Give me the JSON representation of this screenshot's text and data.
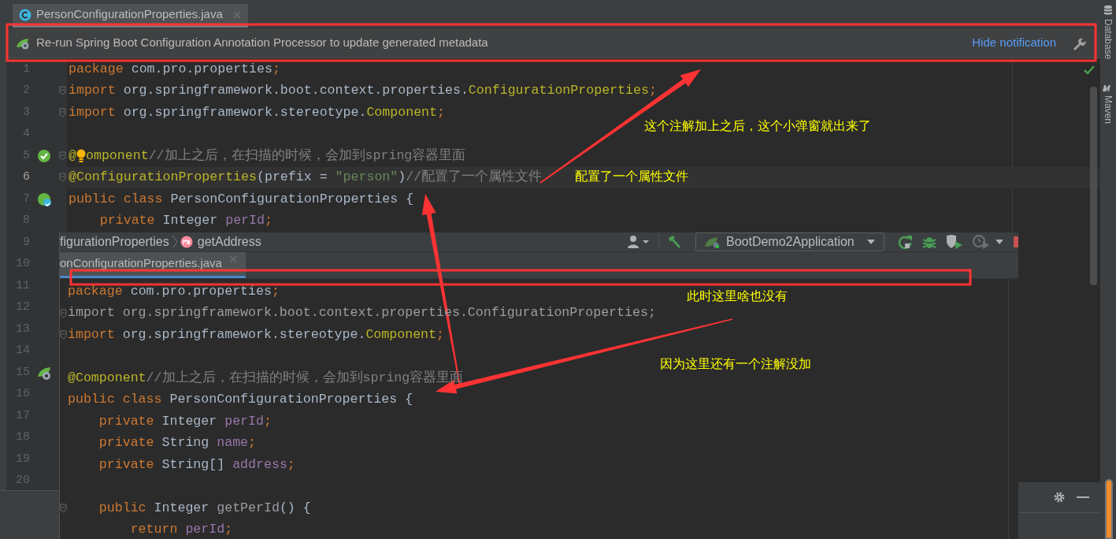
{
  "editor": {
    "tab": {
      "label": "PersonConfigurationProperties.java",
      "selected": true
    },
    "notification": {
      "text": "Re-run Spring Boot Configuration Annotation Processor to update generated metadata",
      "link": "Hide notification"
    },
    "lines": [
      {
        "number": "1",
        "tokens": [
          {
            "kind": "kw",
            "text": "package"
          },
          {
            "kind": "plain",
            "text": " com.pro.properties"
          },
          {
            "kind": "kw",
            "text": ";"
          }
        ]
      },
      {
        "number": "2",
        "fold": true,
        "tokens": [
          {
            "kind": "kw",
            "text": "import"
          },
          {
            "kind": "plain",
            "text": " org.springframework.boot.context.properties."
          },
          {
            "kind": "ann",
            "text": "ConfigurationProperties"
          },
          {
            "kind": "kw",
            "text": ";"
          }
        ]
      },
      {
        "number": "3",
        "fold": true,
        "tokens": [
          {
            "kind": "kw",
            "text": "import"
          },
          {
            "kind": "plain",
            "text": " org.springframework.stereotype."
          },
          {
            "kind": "ann",
            "text": "Component"
          },
          {
            "kind": "kw",
            "text": ";"
          }
        ]
      },
      {
        "number": "4"
      },
      {
        "number": "5",
        "fold": true,
        "gutter_icon": {
          "kind": "bean"
        },
        "bulb": true,
        "tokens": [
          {
            "kind": "ann",
            "text": "@"
          },
          {
            "kind": "ann",
            "text": "omponent"
          },
          {
            "kind": "com",
            "text": "//加上之后，在扫描的时候，会加到spring容器里面"
          }
        ]
      },
      {
        "number": "6",
        "fold": true,
        "current": true,
        "tokens": [
          {
            "kind": "ann",
            "text": "@ConfigurationProperties"
          },
          {
            "kind": "plain",
            "text": "(prefix = "
          },
          {
            "kind": "str",
            "text": "\"person\""
          },
          {
            "kind": "plain",
            "text": ")"
          },
          {
            "kind": "com",
            "text": "//配置了一个属性文件"
          }
        ]
      },
      {
        "number": "7",
        "gutter_icon": {
          "kind": "class"
        },
        "tokens": [
          {
            "kind": "kw",
            "text": "public class"
          },
          {
            "kind": "plain",
            "text": " PersonConfigurationProperties {"
          }
        ]
      },
      {
        "number": "8",
        "tokens": [
          {
            "kind": "kw",
            "text": "    private"
          },
          {
            "kind": "plain",
            "text": " Integer "
          },
          {
            "kind": "field",
            "text": "perId"
          },
          {
            "kind": "kw",
            "text": ";"
          }
        ]
      },
      {
        "number": "9"
      },
      {
        "number": "10"
      },
      {
        "number": "11"
      },
      {
        "number": "12"
      },
      {
        "number": "13"
      },
      {
        "number": "14"
      },
      {
        "number": "15",
        "gutter_icon": {
          "kind": "leaf"
        }
      },
      {
        "number": "16"
      },
      {
        "number": "17"
      },
      {
        "number": "18"
      },
      {
        "number": "19"
      },
      {
        "number": "20"
      }
    ],
    "side_tools": [
      "Database",
      "Maven"
    ]
  },
  "overlay_window": {
    "breadcrumbs": [
      {
        "kind": "class",
        "text": "figurationProperties"
      },
      {
        "kind": "method",
        "text": "getAddress"
      }
    ],
    "run_config": "BootDemo2Application",
    "tab": {
      "label": "onConfigurationProperties.java",
      "selected": true
    },
    "lines": [
      {
        "kind": "code",
        "tokens": [
          {
            "kind": "kw",
            "text": "package"
          },
          {
            "kind": "plain",
            "text": " com.pro.properties"
          },
          {
            "kind": "kw",
            "text": ";"
          }
        ]
      },
      {
        "kind": "code",
        "fold": true,
        "tokens": [
          {
            "kind": "unused",
            "text": "import org.springframework.boot.context.properties.ConfigurationProperties;"
          }
        ]
      },
      {
        "kind": "code",
        "fold": true,
        "tokens": [
          {
            "kind": "kw",
            "text": "import"
          },
          {
            "kind": "plain",
            "text": " org.springframework.stereotype."
          },
          {
            "kind": "ann",
            "text": "Component"
          },
          {
            "kind": "kw",
            "text": ";"
          }
        ]
      },
      {
        "kind": "blank"
      },
      {
        "kind": "code",
        "tokens": [
          {
            "kind": "ann",
            "text": "@Component"
          },
          {
            "kind": "com",
            "text": "//加上之后，在扫描的时候，会加到spring容器里面"
          }
        ]
      },
      {
        "kind": "code",
        "tokens": [
          {
            "kind": "kw",
            "text": "public class"
          },
          {
            "kind": "plain",
            "text": " PersonConfigurationProperties {"
          }
        ]
      },
      {
        "kind": "code",
        "tokens": [
          {
            "kind": "kw",
            "text": "    private"
          },
          {
            "kind": "plain",
            "text": " Integer "
          },
          {
            "kind": "field",
            "text": "perId"
          },
          {
            "kind": "kw",
            "text": ";"
          }
        ]
      },
      {
        "kind": "code",
        "tokens": [
          {
            "kind": "kw",
            "text": "    private"
          },
          {
            "kind": "plain",
            "text": " String "
          },
          {
            "kind": "field",
            "text": "name"
          },
          {
            "kind": "kw",
            "text": ";"
          }
        ]
      },
      {
        "kind": "code",
        "tokens": [
          {
            "kind": "kw",
            "text": "    private"
          },
          {
            "kind": "plain",
            "text": " String[] "
          },
          {
            "kind": "field",
            "text": "address"
          },
          {
            "kind": "kw",
            "text": ";"
          }
        ]
      },
      {
        "kind": "blank"
      },
      {
        "kind": "code",
        "fold": true,
        "tokens": [
          {
            "kind": "kw",
            "text": "    public"
          },
          {
            "kind": "plain",
            "text": " Integer "
          },
          {
            "kind": "unused",
            "text": "getPerId"
          },
          {
            "kind": "plain",
            "text": "() {"
          }
        ]
      },
      {
        "kind": "code",
        "tokens": [
          {
            "kind": "kw",
            "text": "        return "
          },
          {
            "kind": "field",
            "text": "perId"
          },
          {
            "kind": "kw",
            "text": ";"
          }
        ]
      }
    ]
  },
  "annotations": [
    {
      "text": "这个注解加上之后，这个小弹窗就出来了"
    },
    {
      "text": "配置了一个属性文件"
    },
    {
      "text": "此时这里啥也没有"
    },
    {
      "text": "因为这里还有一个注解没加"
    }
  ]
}
